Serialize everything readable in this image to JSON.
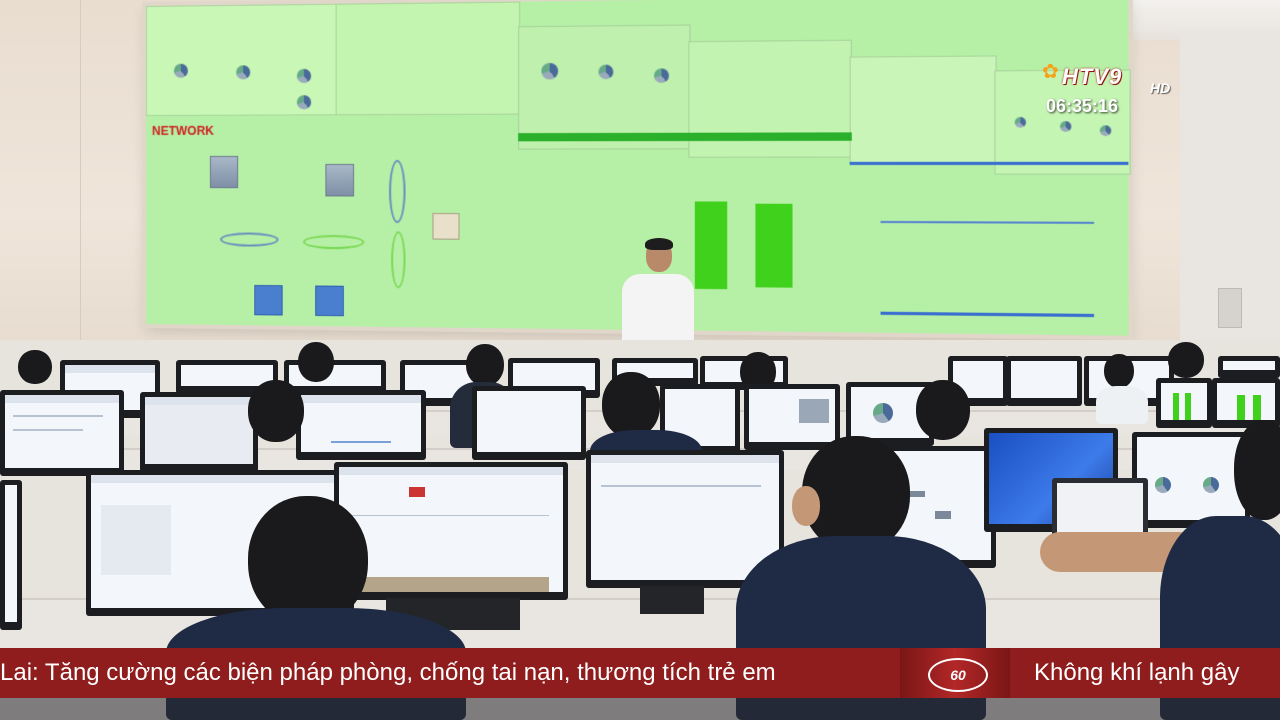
{
  "broadcast": {
    "channel_logo_text": "HTV9",
    "channel_logo_hd": "HD",
    "clock": "06:35:16"
  },
  "video_wall": {
    "network_label": "NETWORK"
  },
  "ticker": {
    "headline_main": "Lai: Tăng cường các biện pháp phòng, chống tai nạn, thương tích trẻ em",
    "headline_next": "Không khí lạnh gây",
    "separator_icon": "news-ticker-logo-icon"
  },
  "colors": {
    "ticker_background": "#8f1d1d",
    "video_wall_background": "#b5f0a6",
    "chart_green": "#3fd11c"
  }
}
